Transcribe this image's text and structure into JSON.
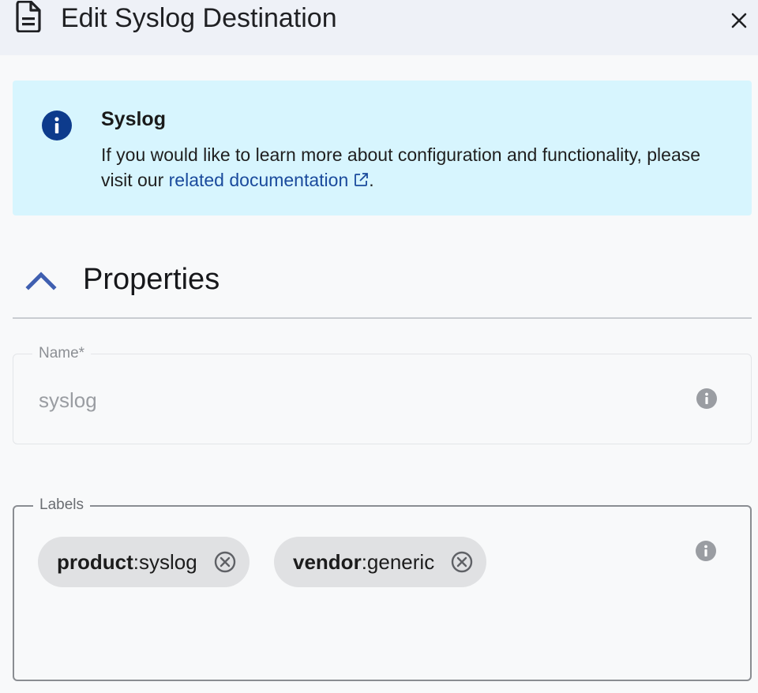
{
  "header": {
    "title": "Edit Syslog Destination",
    "doc_icon": "document-icon",
    "close_icon": "close-icon"
  },
  "banner": {
    "icon": "info-icon",
    "title": "Syslog",
    "text_before": "If you would like to learn more about configuration and functionality, please visit our ",
    "link_text": "related documentation",
    "text_after": ".",
    "link_icon": "external-link-icon",
    "background": "#d7f5fe",
    "accent": "#0d3b8c"
  },
  "properties": {
    "title": "Properties",
    "toggle_icon": "chevron-up-icon"
  },
  "name_field": {
    "label": "Name*",
    "value": "syslog",
    "info_icon": "info-icon"
  },
  "labels_field": {
    "label": "Labels",
    "info_icon": "info-icon",
    "chips": [
      {
        "key": "product",
        "value": "syslog",
        "remove_icon": "remove-circle-icon"
      },
      {
        "key": "vendor",
        "value": "generic",
        "remove_icon": "remove-circle-icon"
      }
    ]
  }
}
